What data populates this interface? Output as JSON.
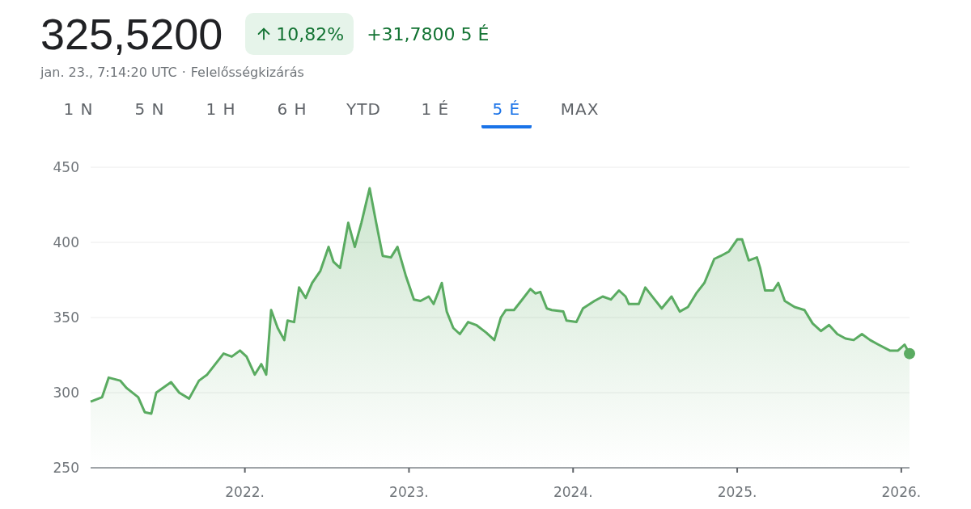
{
  "quote": {
    "price": "325,5200",
    "change_percent": "10,82%",
    "change_amount": "+31,7800 5 É",
    "timestamp": "jan. 23., 7:14:20 UTC",
    "separator": "·",
    "disclaimer": "Felelősségkizárás"
  },
  "tabs": [
    {
      "label": "1 N",
      "selected": false
    },
    {
      "label": "5 N",
      "selected": false
    },
    {
      "label": "1 H",
      "selected": false
    },
    {
      "label": "6 H",
      "selected": false
    },
    {
      "label": "YTD",
      "selected": false
    },
    {
      "label": "1 É",
      "selected": false
    },
    {
      "label": "5 É",
      "selected": true
    },
    {
      "label": "MAX",
      "selected": false
    }
  ],
  "chart": {
    "chart_data": {
      "type": "area",
      "grid": true,
      "xlim": [
        2021.06,
        2026.05
      ],
      "ylim": [
        250,
        450
      ],
      "yticks": [
        250,
        300,
        350,
        400,
        450
      ],
      "xticks": [
        {
          "value": 2022,
          "label": "2022."
        },
        {
          "value": 2023,
          "label": "2023."
        },
        {
          "value": 2024,
          "label": "2024."
        },
        {
          "value": 2025,
          "label": "2025."
        },
        {
          "value": 2026,
          "label": "2026."
        }
      ],
      "x": [
        2021.06,
        2021.13,
        2021.17,
        2021.24,
        2021.28,
        2021.35,
        2021.39,
        2021.43,
        2021.46,
        2021.55,
        2021.6,
        2021.66,
        2021.72,
        2021.77,
        2021.87,
        2021.92,
        2021.97,
        2022.01,
        2022.06,
        2022.1,
        2022.13,
        2022.16,
        2022.2,
        2022.24,
        2022.26,
        2022.3,
        2022.33,
        2022.37,
        2022.41,
        2022.46,
        2022.51,
        2022.54,
        2022.58,
        2022.63,
        2022.67,
        2022.71,
        2022.76,
        2022.8,
        2022.84,
        2022.89,
        2022.93,
        2022.98,
        2023.03,
        2023.07,
        2023.12,
        2023.15,
        2023.2,
        2023.23,
        2023.27,
        2023.31,
        2023.36,
        2023.41,
        2023.47,
        2023.52,
        2023.56,
        2023.59,
        2023.64,
        2023.69,
        2023.74,
        2023.77,
        2023.8,
        2023.84,
        2023.87,
        2023.94,
        2023.96,
        2024.02,
        2024.06,
        2024.13,
        2024.18,
        2024.23,
        2024.28,
        2024.32,
        2024.34,
        2024.4,
        2024.44,
        2024.49,
        2024.54,
        2024.6,
        2024.65,
        2024.7,
        2024.75,
        2024.8,
        2024.86,
        2024.9,
        2024.95,
        2025.0,
        2025.03,
        2025.07,
        2025.12,
        2025.14,
        2025.17,
        2025.22,
        2025.25,
        2025.29,
        2025.35,
        2025.41,
        2025.46,
        2025.51,
        2025.56,
        2025.61,
        2025.66,
        2025.71,
        2025.76,
        2025.81,
        2025.86,
        2025.93,
        2025.98,
        2026.02,
        2026.05
      ],
      "series": [
        {
          "color": "#5aab61",
          "values": [
            294,
            297,
            310,
            308,
            303,
            297,
            287,
            286,
            300,
            307,
            300,
            296,
            308,
            312,
            326,
            324,
            328,
            324,
            312,
            319,
            312,
            355,
            343,
            335,
            348,
            347,
            370,
            363,
            373,
            381,
            397,
            387,
            383,
            413,
            397,
            413,
            436,
            413,
            391,
            390,
            397,
            378,
            362,
            361,
            364,
            359,
            373,
            354,
            343,
            339,
            347,
            345,
            340,
            335,
            350,
            355,
            355,
            362,
            369,
            366,
            367,
            356,
            355,
            354,
            348,
            347,
            356,
            361,
            364,
            362,
            368,
            364,
            359,
            359,
            370,
            363,
            356,
            364,
            354,
            357,
            366,
            373,
            389,
            391,
            394,
            402,
            402,
            388,
            390,
            383,
            368,
            368,
            373,
            361,
            357,
            355,
            346,
            341,
            345,
            339,
            336,
            335,
            339,
            335,
            332,
            328,
            328,
            332,
            326
          ]
        }
      ]
    }
  }
}
